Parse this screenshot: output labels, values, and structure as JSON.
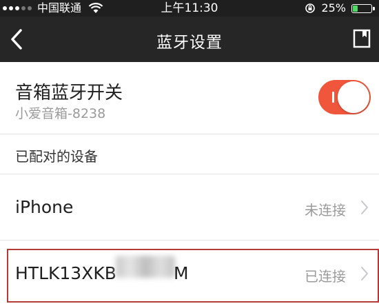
{
  "status_bar": {
    "carrier": "中国联通",
    "time": "上午11:30",
    "battery": "25%",
    "battery_level": 0.25
  },
  "nav": {
    "title": "蓝牙设置",
    "back_icon": "chevron-left-icon",
    "action_icon": "bookmark-icon"
  },
  "speaker": {
    "title": "音箱蓝牙开关",
    "subtitle": "小爱音箱-8238",
    "toggle_on": true,
    "toggle_color": "#f0563b"
  },
  "section": {
    "paired_header": "已配对的设备"
  },
  "devices": [
    {
      "name": "iPhone",
      "status": "未连接"
    },
    {
      "name": "HTLK13XKB",
      "name_suffix": "M",
      "status": "已连接"
    }
  ]
}
